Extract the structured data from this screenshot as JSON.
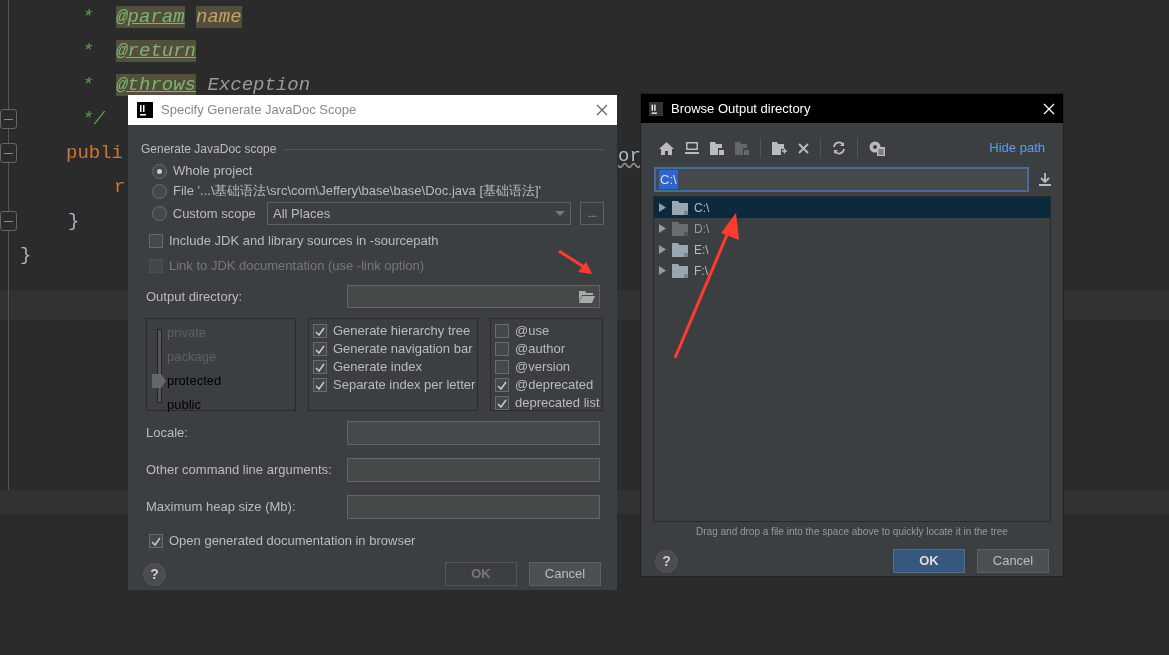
{
  "editor": {
    "lines": [
      {
        "segments": [
          {
            "kind": "comment",
            "text": "* "
          },
          {
            "kind": "tag",
            "text": "@param"
          },
          {
            "kind": "param",
            "text": "name"
          }
        ]
      },
      {
        "segments": [
          {
            "kind": "comment",
            "text": "* "
          },
          {
            "kind": "tag",
            "text": "@return"
          }
        ]
      },
      {
        "segments": [
          {
            "kind": "comment",
            "text": "* "
          },
          {
            "kind": "tag",
            "text": "@throws"
          },
          {
            "kind": "type",
            "text": "Exception"
          }
        ]
      },
      {
        "segments": [
          {
            "kind": "comment",
            "text": "*/"
          }
        ]
      },
      {
        "segments": [
          {
            "kind": "keyword",
            "text": "publi"
          }
        ],
        "tail": "or"
      },
      {
        "segments": [
          {
            "kind": "keyword",
            "text": "r"
          }
        ]
      },
      {
        "segments": [
          {
            "kind": "brace",
            "text": "}"
          }
        ]
      },
      {
        "segments": [
          {
            "kind": "brace",
            "text": "}"
          }
        ]
      }
    ]
  },
  "javadoc_dialog": {
    "title": "Specify Generate JavaDoc Scope",
    "scope_group": "Generate JavaDoc scope",
    "scopes": [
      {
        "label": "Whole project",
        "selected": true
      },
      {
        "label": "File '...\\基础语法\\src\\com\\Jeffery\\base\\base\\Doc.java [基础语法]'",
        "selected": false
      },
      {
        "label": "Custom scope",
        "selected": false,
        "dropdown": "All Places",
        "more": "..."
      }
    ],
    "options": [
      {
        "label": "Include JDK and library sources in -sourcepath",
        "checked": false,
        "disabled": false
      },
      {
        "label": "Link to JDK documentation (use -link option)",
        "checked": false,
        "disabled": true
      }
    ],
    "output_directory": {
      "label": "Output directory:"
    },
    "visibility_levels": [
      {
        "label": "private",
        "selected": false
      },
      {
        "label": "package",
        "selected": false
      },
      {
        "label": "protected",
        "selected": true
      },
      {
        "label": "public",
        "selected": false
      }
    ],
    "generate_options": [
      {
        "label": "Generate hierarchy tree",
        "checked": true
      },
      {
        "label": "Generate navigation bar",
        "checked": true
      },
      {
        "label": "Generate index",
        "checked": true
      },
      {
        "label": "Separate index per letter",
        "checked": true
      }
    ],
    "tag_options": [
      {
        "label": "@use",
        "checked": false
      },
      {
        "label": "@author",
        "checked": false
      },
      {
        "label": "@version",
        "checked": false
      },
      {
        "label": "@deprecated",
        "checked": true
      },
      {
        "label": "deprecated list",
        "checked": true
      }
    ],
    "fields": [
      {
        "label": "Locale:"
      },
      {
        "label": "Other command line arguments:"
      },
      {
        "label": "Maximum heap size (Mb):"
      }
    ],
    "open_in_browser": {
      "label": "Open generated documentation in browser",
      "checked": true
    },
    "help": "?",
    "buttons": [
      {
        "label": "OK",
        "disabled": true
      },
      {
        "label": "Cancel",
        "disabled": false
      }
    ]
  },
  "browse_dialog": {
    "title": "Browse Output directory",
    "hide_path": "Hide path",
    "path": "C:\\",
    "tree": [
      {
        "label": "C:\\",
        "selected": true,
        "dimmed": false
      },
      {
        "label": "D:\\",
        "selected": false,
        "dimmed": true
      },
      {
        "label": "E:\\",
        "selected": false,
        "dimmed": false
      },
      {
        "label": "F:\\",
        "selected": false,
        "dimmed": false
      }
    ],
    "hint": "Drag and drop a file into the space above to quickly locate it in the tree",
    "help": "?",
    "buttons": [
      {
        "label": "OK",
        "primary": true
      },
      {
        "label": "Cancel",
        "primary": false
      }
    ]
  }
}
